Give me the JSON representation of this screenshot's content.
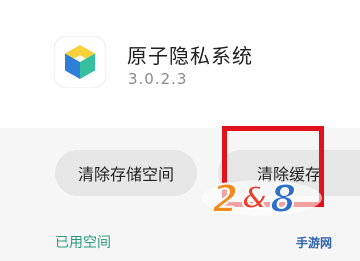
{
  "app": {
    "name": "原子隐私系统",
    "version": "3.0.2.3",
    "icon": "cube-icon"
  },
  "buttons": {
    "clear_storage": "清除存储空间",
    "clear_cache": "清除缓存"
  },
  "section": {
    "used_space": "已用空间"
  },
  "watermark": {
    "logo": "2&8",
    "sub": "手游网"
  },
  "colors": {
    "highlight": "#e0121b",
    "accent": "#2a9b78"
  }
}
